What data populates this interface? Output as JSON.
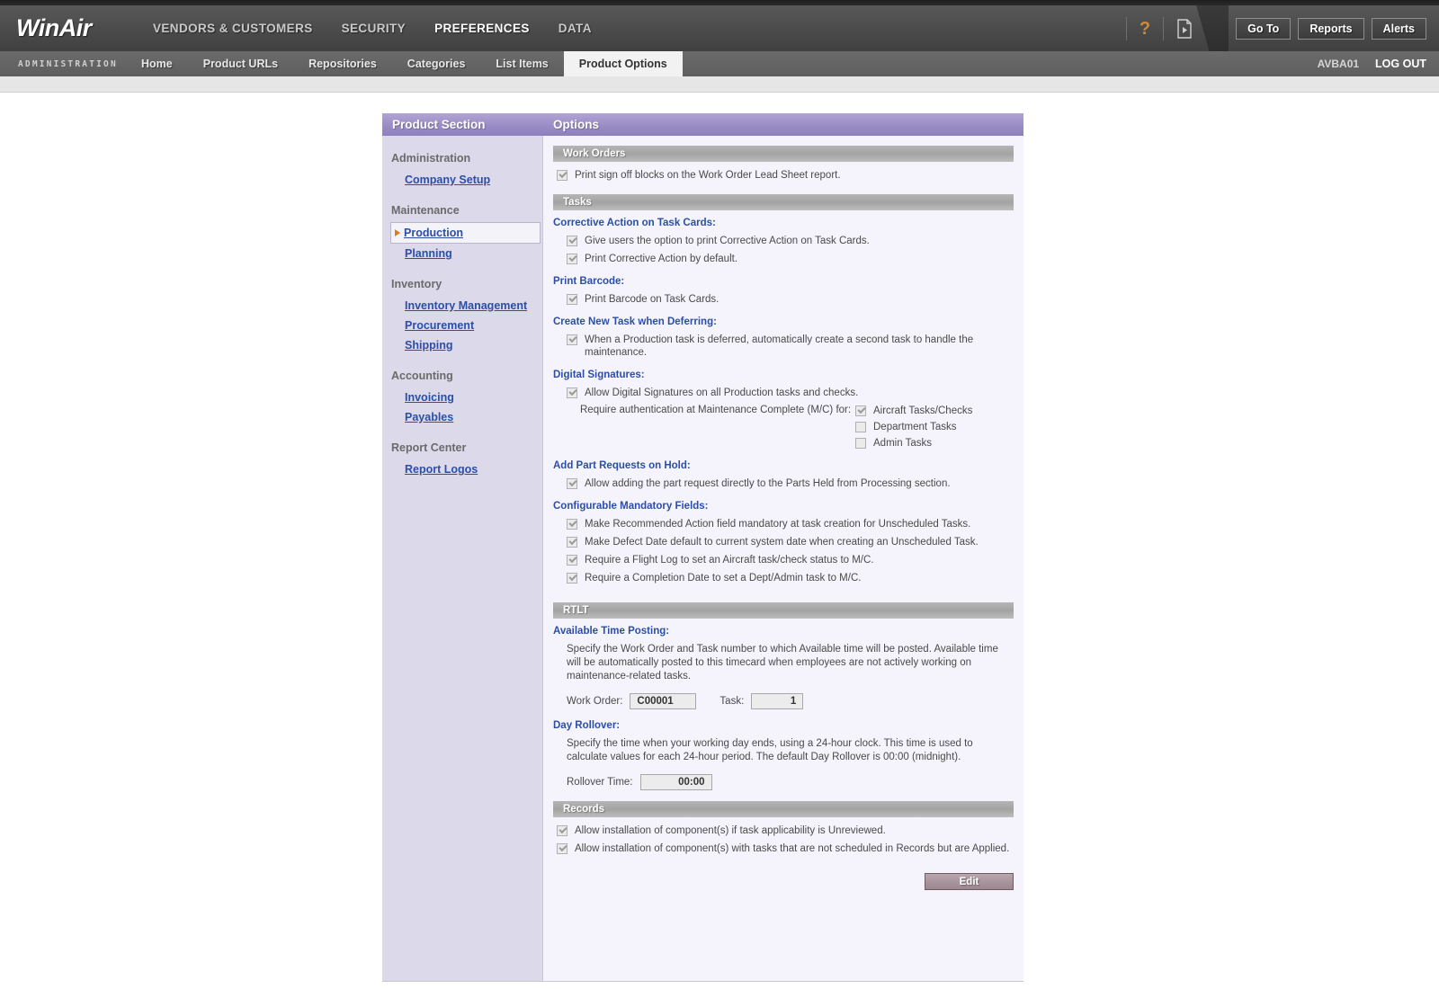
{
  "header": {
    "logo": "WinAir",
    "main_nav": [
      {
        "label": "VENDORS & CUSTOMERS",
        "active": false
      },
      {
        "label": "SECURITY",
        "active": false
      },
      {
        "label": "PREFERENCES",
        "active": true
      },
      {
        "label": "DATA",
        "active": false
      }
    ],
    "help_icon": "?",
    "doc_icon": "document-play-icon",
    "buttons": [
      {
        "label": "Go To"
      },
      {
        "label": "Reports"
      },
      {
        "label": "Alerts"
      }
    ]
  },
  "subheader": {
    "section_label": "ADMINISTRATION",
    "tabs": [
      {
        "label": "Home",
        "active": false
      },
      {
        "label": "Product URLs",
        "active": false
      },
      {
        "label": "Repositories",
        "active": false
      },
      {
        "label": "Categories",
        "active": false
      },
      {
        "label": "List Items",
        "active": false
      },
      {
        "label": "Product Options",
        "active": true
      }
    ],
    "user_id": "AVBA01",
    "logout": "LOG OUT"
  },
  "sidebar": {
    "title": "Product Section",
    "groups": [
      {
        "label": "Administration",
        "links": [
          {
            "label": "Company Setup",
            "selected": false
          }
        ]
      },
      {
        "label": "Maintenance",
        "links": [
          {
            "label": "Production",
            "selected": true
          },
          {
            "label": "Planning",
            "selected": false
          }
        ]
      },
      {
        "label": "Inventory",
        "links": [
          {
            "label": "Inventory Management",
            "selected": false
          },
          {
            "label": "Procurement",
            "selected": false
          },
          {
            "label": "Shipping",
            "selected": false
          }
        ]
      },
      {
        "label": "Accounting",
        "links": [
          {
            "label": "Invoicing",
            "selected": false
          },
          {
            "label": "Payables",
            "selected": false
          }
        ]
      },
      {
        "label": "Report Center",
        "links": [
          {
            "label": "Report Logos",
            "selected": false
          }
        ]
      }
    ]
  },
  "options": {
    "title": "Options",
    "work_orders": {
      "section_label": "Work Orders",
      "checkboxes": [
        {
          "label": "Print sign off blocks on the Work Order Lead Sheet report.",
          "checked": true
        }
      ]
    },
    "tasks": {
      "section_label": "Tasks",
      "corrective_action": {
        "heading": "Corrective Action on Task Cards:",
        "checkboxes": [
          {
            "label": "Give users the option to print Corrective Action on Task Cards.",
            "checked": true
          },
          {
            "label": "Print Corrective Action by default.",
            "checked": true
          }
        ]
      },
      "print_barcode": {
        "heading": "Print Barcode:",
        "checkboxes": [
          {
            "label": "Print Barcode on Task Cards.",
            "checked": true
          }
        ]
      },
      "create_new_task": {
        "heading": "Create New Task when Deferring:",
        "checkboxes": [
          {
            "label": "When a Production task is deferred, automatically create a second task to handle the maintenance.",
            "checked": true
          }
        ]
      },
      "digital_signatures": {
        "heading": "Digital Signatures:",
        "checkboxes": [
          {
            "label": "Allow Digital Signatures on all Production tasks and checks.",
            "checked": true
          }
        ],
        "auth_label": "Require authentication at Maintenance Complete (M/C) for:",
        "auth_options": [
          {
            "label": "Aircraft Tasks/Checks",
            "checked": true
          },
          {
            "label": "Department Tasks",
            "checked": false
          },
          {
            "label": "Admin Tasks",
            "checked": false
          }
        ]
      },
      "part_requests": {
        "heading": "Add Part Requests on Hold:",
        "checkboxes": [
          {
            "label": "Allow adding the part request directly to the Parts Held from Processing section.",
            "checked": true
          }
        ]
      },
      "mandatory_fields": {
        "heading": "Configurable Mandatory Fields:",
        "checkboxes": [
          {
            "label": "Make Recommended Action field mandatory at task creation for Unscheduled Tasks.",
            "checked": true
          },
          {
            "label": "Make Defect Date default to current system date when creating an Unscheduled Task.",
            "checked": true
          },
          {
            "label": "Require a Flight Log to set an Aircraft task/check status to M/C.",
            "checked": true
          },
          {
            "label": "Require a Completion Date to set a Dept/Admin task to M/C.",
            "checked": true
          }
        ]
      }
    },
    "rtlt": {
      "section_label": "RTLT",
      "available_time": {
        "heading": "Available Time Posting:",
        "description": "Specify the Work Order and Task number to which Available time will be posted. Available time will be automatically posted to this timecard when employees are not actively working on maintenance-related tasks.",
        "work_order_label": "Work Order:",
        "work_order_value": "C00001",
        "task_label": "Task:",
        "task_value": "1"
      },
      "day_rollover": {
        "heading": "Day Rollover:",
        "description": "Specify the time when your working day ends, using a 24-hour clock. This time is used to calculate values for each 24-hour period. The default Day Rollover is 00:00 (midnight).",
        "rollover_label": "Rollover Time:",
        "rollover_value": "00:00"
      }
    },
    "records": {
      "section_label": "Records",
      "checkboxes": [
        {
          "label": "Allow installation of component(s) if task applicability is Unreviewed.",
          "checked": true
        },
        {
          "label": "Allow installation of component(s) with tasks that are not scheduled in Records but are Applied.",
          "checked": true
        }
      ]
    },
    "edit_button": "Edit"
  },
  "colors": {
    "accent_purple": "#9a8cc6",
    "link_blue": "#2b4fa8",
    "marker_orange": "#e07b18",
    "edit_button": "#a9959d",
    "sidebar_bg": "#dcdaea",
    "panel_bg": "#f5f3fb"
  }
}
